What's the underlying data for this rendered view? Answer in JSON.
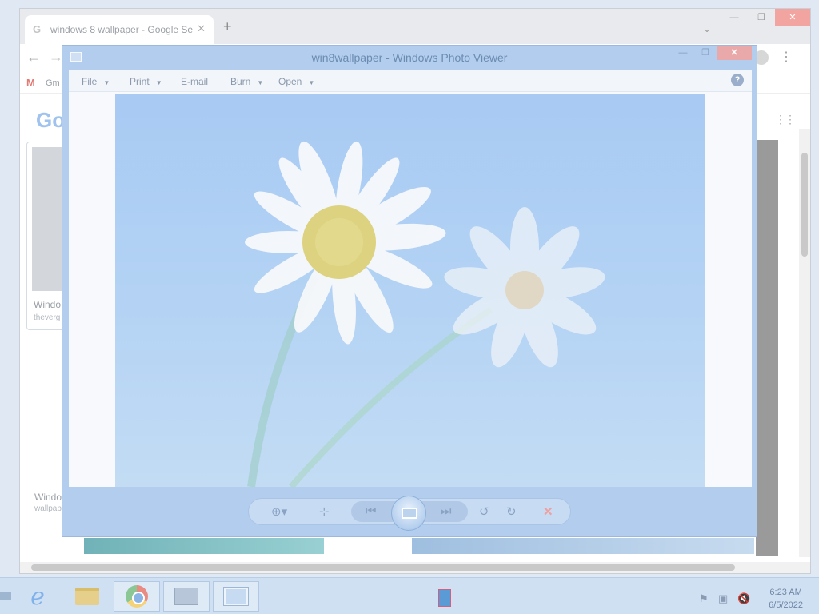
{
  "chrome": {
    "tab_title": "windows 8 wallpaper - Google Se",
    "tab_close": "✕",
    "new_tab": "+",
    "tab_menu": "⌄",
    "window_buttons": [
      "—",
      "❐",
      "✕"
    ],
    "back": "←",
    "forward": "→",
    "menu": "⋮",
    "bookmark_gmail_icon": "M",
    "bookmark_gmail": "Gm",
    "google_logo": "Go",
    "apps": "⋮⋮",
    "result1": {
      "title": "Windo",
      "source": "theverg"
    },
    "result2": {
      "title": "Windo",
      "source": "wallpap"
    }
  },
  "photo_viewer": {
    "title": "win8wallpaper - Windows Photo Viewer",
    "window_buttons": [
      "—",
      "❐",
      "✕"
    ],
    "menu": [
      {
        "label": "File",
        "arrow": "▼"
      },
      {
        "label": "Print",
        "arrow": "▼"
      },
      {
        "label": "E-mail",
        "arrow": ""
      },
      {
        "label": "Burn",
        "arrow": "▼"
      },
      {
        "label": "Open",
        "arrow": "▼"
      }
    ],
    "help": "?",
    "controls": {
      "zoom": "⊕▾",
      "actual_size": "⊹",
      "previous": "⏮",
      "next": "⏭",
      "rotate_ccw": "↺",
      "rotate_cw": "↻",
      "delete": "✕"
    }
  },
  "taskbar": {
    "ie": "e",
    "tray_flag": "⚑",
    "tray_network": "▣",
    "tray_volume": "🔇",
    "time": "6:23 AM",
    "date": "6/5/2022"
  }
}
